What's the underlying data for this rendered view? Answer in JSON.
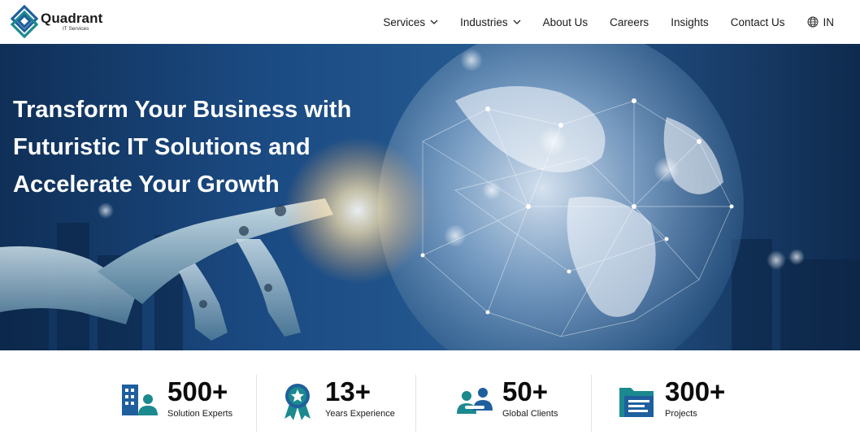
{
  "brand": {
    "name": "Quadrant",
    "tagline": "IT Services"
  },
  "nav": {
    "items": [
      {
        "label": "Services",
        "dropdown": true
      },
      {
        "label": "Industries",
        "dropdown": true
      },
      {
        "label": "About Us",
        "dropdown": false
      },
      {
        "label": "Careers",
        "dropdown": false
      },
      {
        "label": "Insights",
        "dropdown": false
      },
      {
        "label": "Contact Us",
        "dropdown": false
      }
    ],
    "region": "IN"
  },
  "hero": {
    "title_lines": [
      "Transform Your Business with",
      "Futuristic IT Solutions and",
      "Accelerate Your Growth"
    ]
  },
  "stats": [
    {
      "value": "500+",
      "label": "Solution Experts",
      "icon": "building-person-icon"
    },
    {
      "value": "13+",
      "label": "Years Experience",
      "icon": "award-badge-icon"
    },
    {
      "value": "50+",
      "label": "Global Clients",
      "icon": "clients-group-icon"
    },
    {
      "value": "300+",
      "label": "Projects",
      "icon": "folder-document-icon"
    }
  ],
  "colors": {
    "accent_teal": "#1b8a8f",
    "accent_blue": "#1f5f9e",
    "hero_dark": "#0f2f57"
  }
}
